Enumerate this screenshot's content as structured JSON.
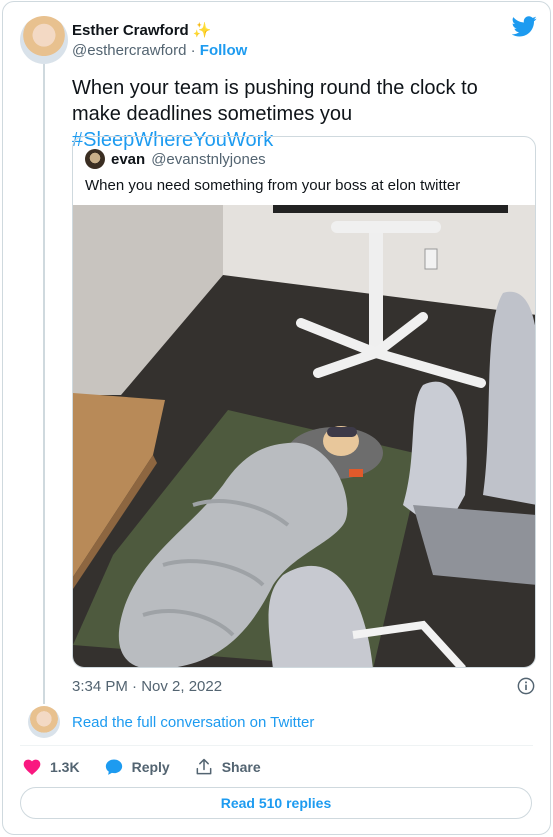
{
  "author": {
    "name": "Esther Crawford",
    "emoji": "✨",
    "handle": "@esthercrawford",
    "separator": "·",
    "follow_label": "Follow"
  },
  "tweet": {
    "text_prefix": "When your team is pushing round the clock to make deadlines sometimes you ",
    "hashtag": "#SleepWhereYouWork"
  },
  "quoted": {
    "name": "evan",
    "handle": "@evanstnlyjones",
    "text": "When you need something from your boss at elon twitter"
  },
  "timestamp": "3:34 PM · Nov 2, 2022",
  "conversation_link": "Read the full conversation on Twitter",
  "actions": {
    "likes": "1.3K",
    "reply_label": "Reply",
    "share_label": "Share"
  },
  "replies_button": "Read 510 replies",
  "colors": {
    "accent": "#1d9bf0",
    "like": "#f91880",
    "text": "#0f1419",
    "muted": "#536471"
  },
  "icons": [
    "twitter-bird-icon",
    "info-icon",
    "heart-icon",
    "reply-bubble-icon",
    "share-icon"
  ]
}
